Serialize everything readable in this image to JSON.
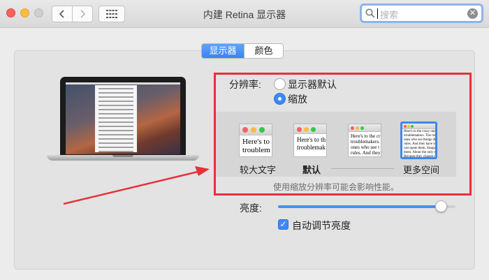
{
  "window": {
    "title": "内建 Retina 显示器"
  },
  "search": {
    "placeholder": "搜索"
  },
  "tabs": [
    {
      "label": "显示器",
      "selected": true
    },
    {
      "label": "颜色",
      "selected": false
    }
  ],
  "resolution": {
    "label": "分辨率:",
    "options": [
      {
        "label": "显示器默认",
        "selected": false
      },
      {
        "label": "缩放",
        "selected": true
      }
    ],
    "scaled": [
      {
        "label": "较大文字",
        "lines": [
          "Here's to",
          "troublem"
        ]
      },
      {
        "label": "默认",
        "lines": [
          "Here's to th",
          "troublemak"
        ]
      },
      {
        "label": "",
        "lines": [
          "Here's to the cr",
          "troublemakers.",
          "ones who see t",
          "rules. And they"
        ]
      },
      {
        "label": "更多空间",
        "lines": [
          "Here's to the crazy ones",
          "troublemakers. The rou",
          "ones who see things di",
          "rules. And they have no",
          "can quote them, disagre",
          "them. About the only th",
          "Because they change th"
        ]
      }
    ],
    "hint": "使用缩放分辨率可能会影响性能。"
  },
  "brightness": {
    "label": "亮度:",
    "value": 0.92
  },
  "auto_brightness": {
    "label": "自动调节亮度",
    "checked": true
  },
  "colors": {
    "accent": "#3d8af7",
    "highlight": "#e8303a"
  }
}
